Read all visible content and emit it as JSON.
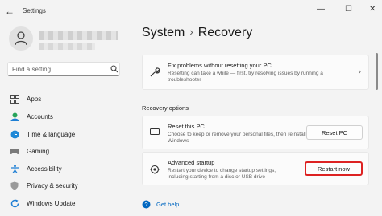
{
  "window": {
    "back_glyph": "←",
    "title": "Settings",
    "minimize_glyph": "—",
    "maximize_glyph": "☐",
    "close_glyph": "✕"
  },
  "search": {
    "placeholder": "Find a setting"
  },
  "sidebar": {
    "items": [
      {
        "label": "Apps",
        "icon": "apps-icon"
      },
      {
        "label": "Accounts",
        "icon": "accounts-icon"
      },
      {
        "label": "Time & language",
        "icon": "time-language-icon"
      },
      {
        "label": "Gaming",
        "icon": "gaming-icon"
      },
      {
        "label": "Accessibility",
        "icon": "accessibility-icon"
      },
      {
        "label": "Privacy & security",
        "icon": "privacy-shield-icon"
      },
      {
        "label": "Windows Update",
        "icon": "windows-update-icon"
      }
    ]
  },
  "header": {
    "section": "System",
    "separator": "›",
    "page": "Recovery"
  },
  "fix_card": {
    "title": "Fix problems without resetting your PC",
    "desc_line1": "Resetting can take a while — first, try resolving issues by running a",
    "desc_line2": "troubleshooter",
    "chevron": "›"
  },
  "recovery_options": {
    "label": "Recovery options",
    "reset": {
      "title": "Reset this PC",
      "desc_line1": "Choose to keep or remove your personal files, then reinstall",
      "desc_line2": "Windows",
      "button": "Reset PC"
    },
    "advanced": {
      "title": "Advanced startup",
      "desc_line1": "Restart your device to change startup settings,",
      "desc_line2": "including starting from a disc or USB drive",
      "button": "Restart now"
    }
  },
  "help": {
    "label": "Get help"
  },
  "colors": {
    "accent": "#0067c0",
    "highlight_border": "#dd2222",
    "background": "#f3f3f3"
  }
}
